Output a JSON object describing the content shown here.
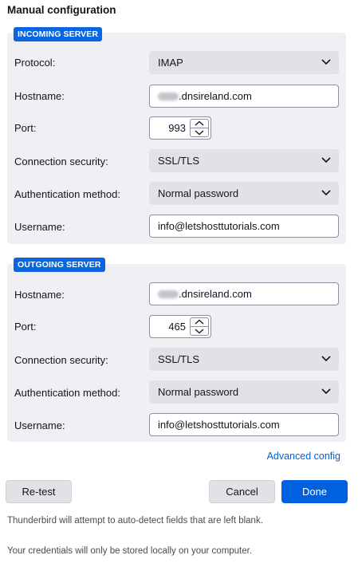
{
  "title": "Manual configuration",
  "incoming": {
    "badge": "INCOMING SERVER",
    "protocol_label": "Protocol:",
    "protocol_value": "IMAP",
    "hostname_label": "Hostname:",
    "hostname_value": ".dnsireland.com",
    "port_label": "Port:",
    "port_value": "993",
    "security_label": "Connection security:",
    "security_value": "SSL/TLS",
    "auth_label": "Authentication method:",
    "auth_value": "Normal password",
    "username_label": "Username:",
    "username_value": "info@letshosttutorials.com"
  },
  "outgoing": {
    "badge": "OUTGOING SERVER",
    "hostname_label": "Hostname:",
    "hostname_value": ".dnsireland.com",
    "port_label": "Port:",
    "port_value": "465",
    "security_label": "Connection security:",
    "security_value": "SSL/TLS",
    "auth_label": "Authentication method:",
    "auth_value": "Normal password",
    "username_label": "Username:",
    "username_value": "info@letshosttutorials.com"
  },
  "advanced_link": "Advanced config",
  "buttons": {
    "retest": "Re-test",
    "cancel": "Cancel",
    "done": "Done"
  },
  "notes": {
    "autodetect": "Thunderbird will attempt to auto-detect fields that are left blank.",
    "credentials": "Your credentials will only be stored locally on your computer."
  },
  "icons": {
    "dropdown": "chevron-down-icon",
    "spin_up": "chevron-up-icon",
    "spin_down": "chevron-down-icon"
  },
  "colors": {
    "accent": "#0061e0",
    "badge": "#0a66e0",
    "section_bg": "#f0f0f4"
  }
}
